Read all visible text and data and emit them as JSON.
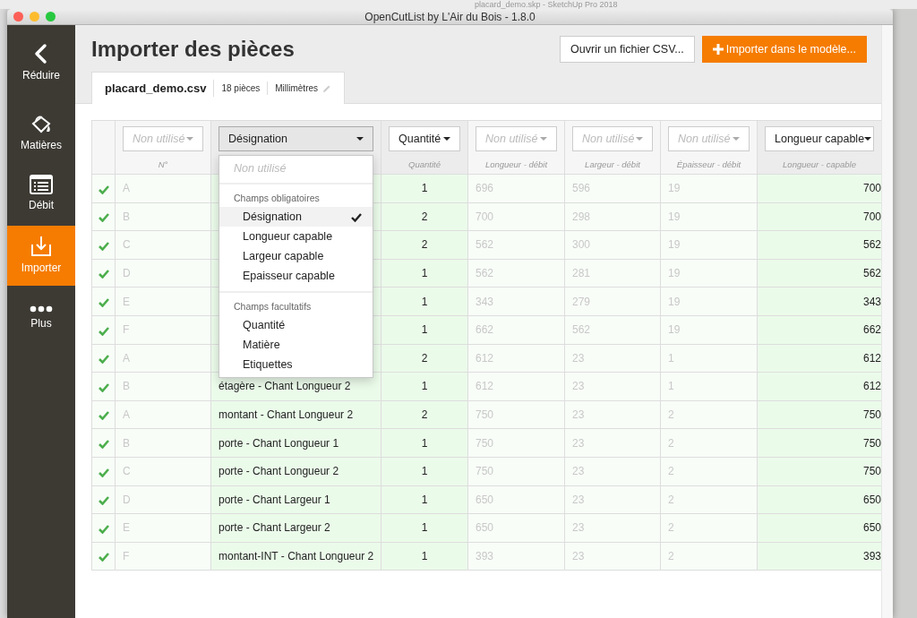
{
  "desktop": {
    "background_window_title": "placard_demo.skp - SketchUp Pro 2018"
  },
  "window": {
    "title": "OpenCutList by L'Air du Bois - 1.8.0"
  },
  "sidebar": {
    "items": [
      {
        "kind": "back",
        "label": "Réduire",
        "selected": false
      },
      {
        "kind": "materials",
        "label": "Matières",
        "selected": false
      },
      {
        "kind": "cutlist",
        "label": "Débit",
        "selected": false
      },
      {
        "kind": "import",
        "label": "Importer",
        "selected": true
      },
      {
        "kind": "more",
        "label": "Plus",
        "selected": false
      }
    ]
  },
  "page": {
    "title": "Importer des pièces",
    "buttons": [
      {
        "kind": "default",
        "label": "Ouvrir un fichier CSV..."
      },
      {
        "kind": "primary",
        "label": "Importer dans le modèle..."
      }
    ]
  },
  "file_tab": {
    "filename": "placard_demo.csv",
    "count": "18 pièces",
    "unit": "Millimètres"
  },
  "table": {
    "columns": [
      {
        "mapping": "Non utilisé",
        "unused": true,
        "open": false,
        "label": "N°"
      },
      {
        "mapping": "Désignation",
        "unused": false,
        "open": true
      },
      {
        "mapping": "Quantité",
        "unused": false,
        "open": false,
        "label": "Quantité"
      },
      {
        "mapping": "Non utilisé",
        "unused": true,
        "open": false,
        "label": "Longueur - débit"
      },
      {
        "mapping": "Non utilisé",
        "unused": true,
        "open": false,
        "label": "Largeur - débit"
      },
      {
        "mapping": "Non utilisé",
        "unused": true,
        "open": false,
        "label": "Épaisseur - débit"
      },
      {
        "mapping": "Longueur capable",
        "unused": false,
        "open": false,
        "label": "Longueur - capable"
      }
    ],
    "rows": [
      {
        "valid": true,
        "number": "A",
        "quantity": "1",
        "length_raw": "696",
        "width_raw": "596",
        "thickness_raw": "19",
        "length": "700"
      },
      {
        "valid": true,
        "number": "B",
        "quantity": "2",
        "length_raw": "700",
        "width_raw": "298",
        "thickness_raw": "19",
        "length": "700"
      },
      {
        "valid": true,
        "number": "C",
        "quantity": "2",
        "length_raw": "562",
        "width_raw": "300",
        "thickness_raw": "19",
        "length": "562"
      },
      {
        "valid": true,
        "number": "D",
        "quantity": "1",
        "length_raw": "562",
        "width_raw": "281",
        "thickness_raw": "19",
        "length": "562"
      },
      {
        "valid": true,
        "number": "E",
        "quantity": "1",
        "length_raw": "343",
        "width_raw": "279",
        "thickness_raw": "19",
        "length": "343"
      },
      {
        "valid": true,
        "number": "F",
        "quantity": "1",
        "length_raw": "662",
        "width_raw": "562",
        "thickness_raw": "19",
        "length": "662"
      },
      {
        "valid": true,
        "number": "A",
        "quantity": "2",
        "length_raw": "612",
        "width_raw": "23",
        "thickness_raw": "1",
        "length": "612"
      },
      {
        "valid": true,
        "number": "B",
        "designation": "étagère - Chant Longueur 2",
        "quantity": "1",
        "length_raw": "612",
        "width_raw": "23",
        "thickness_raw": "1",
        "length": "612"
      },
      {
        "valid": true,
        "number": "A",
        "designation": "montant - Chant Longueur 2",
        "quantity": "2",
        "length_raw": "750",
        "width_raw": "23",
        "thickness_raw": "2",
        "length": "750"
      },
      {
        "valid": true,
        "number": "B",
        "designation": "porte - Chant Longueur 1",
        "quantity": "1",
        "length_raw": "750",
        "width_raw": "23",
        "thickness_raw": "2",
        "length": "750"
      },
      {
        "valid": true,
        "number": "C",
        "designation": "porte - Chant Longueur 2",
        "quantity": "1",
        "length_raw": "750",
        "width_raw": "23",
        "thickness_raw": "2",
        "length": "750"
      },
      {
        "valid": true,
        "number": "D",
        "designation": "porte - Chant Largeur 1",
        "quantity": "1",
        "length_raw": "650",
        "width_raw": "23",
        "thickness_raw": "2",
        "length": "650"
      },
      {
        "valid": true,
        "number": "E",
        "designation": "porte - Chant Largeur 2",
        "quantity": "1",
        "length_raw": "650",
        "width_raw": "23",
        "thickness_raw": "2",
        "length": "650"
      },
      {
        "valid": true,
        "number": "F",
        "designation": "montant-INT - Chant Longueur 2",
        "quantity": "1",
        "length_raw": "393",
        "width_raw": "23",
        "thickness_raw": "2",
        "length": "393"
      }
    ]
  },
  "dropdown": {
    "items": [
      {
        "kind": "none",
        "label": "Non utilisé",
        "selected": false
      },
      {
        "kind": "divider"
      },
      {
        "kind": "header",
        "label": "Champs obligatoires"
      },
      {
        "kind": "option",
        "label": "Désignation",
        "selected": true
      },
      {
        "kind": "option",
        "label": "Longueur capable",
        "selected": false
      },
      {
        "kind": "option",
        "label": "Largeur capable",
        "selected": false
      },
      {
        "kind": "option",
        "label": "Epaisseur capable",
        "selected": false
      },
      {
        "kind": "divider"
      },
      {
        "kind": "header",
        "label": "Champs facultatifs"
      },
      {
        "kind": "option",
        "label": "Quantité",
        "selected": false
      },
      {
        "kind": "option",
        "label": "Matière",
        "selected": false
      },
      {
        "kind": "option",
        "label": "Etiquettes",
        "selected": false
      }
    ]
  }
}
